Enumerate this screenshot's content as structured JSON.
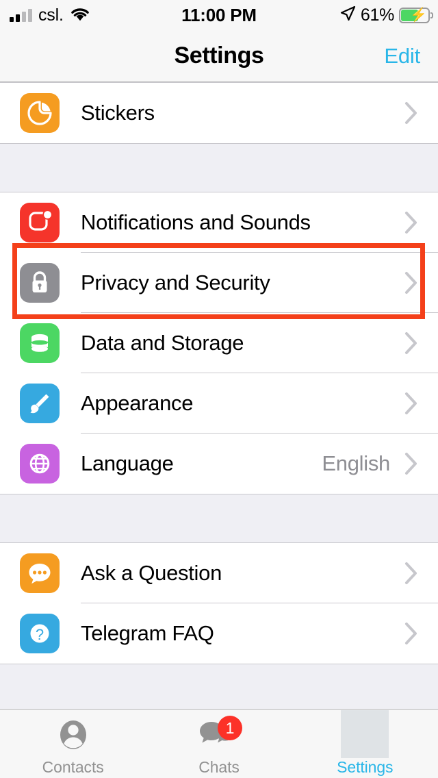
{
  "status_bar": {
    "carrier": "csl.",
    "signal_icon": "cellular-bars-icon",
    "wifi_icon": "wifi-icon",
    "time": "11:00 PM",
    "location_icon": "location-arrow-icon",
    "battery_percent": "61%",
    "battery_icon": "battery-charging-icon",
    "battery_level": 61
  },
  "nav": {
    "title": "Settings",
    "edit_label": "Edit"
  },
  "sections": [
    {
      "rows": [
        {
          "label": "Stickers",
          "value": "",
          "icon": "sticker-icon",
          "icon_color": "#f59c21",
          "chevron": true
        }
      ]
    },
    {
      "rows": [
        {
          "label": "Notifications and Sounds",
          "value": "",
          "icon": "notifications-icon",
          "icon_color": "#f5342b",
          "chevron": true
        },
        {
          "label": "Privacy and Security",
          "value": "",
          "icon": "lock-icon",
          "icon_color": "#8e8e93",
          "chevron": true
        },
        {
          "label": "Data and Storage",
          "value": "",
          "icon": "database-icon",
          "icon_color": "#4cd763",
          "chevron": true
        },
        {
          "label": "Appearance",
          "value": "",
          "icon": "paintbrush-icon",
          "icon_color": "#36a9e0",
          "chevron": true
        },
        {
          "label": "Language",
          "value": "English",
          "icon": "globe-icon",
          "icon_color": "#c863e0",
          "chevron": true
        }
      ]
    },
    {
      "rows": [
        {
          "label": "Ask a Question",
          "value": "",
          "icon": "chat-bubble-dots-icon",
          "icon_color": "#f59c21",
          "chevron": true
        },
        {
          "label": "Telegram FAQ",
          "value": "",
          "icon": "question-mark-icon",
          "icon_color": "#36a9e0",
          "chevron": true
        }
      ]
    }
  ],
  "highlight": {
    "target": "Privacy and Security",
    "color": "#f4401a"
  },
  "tabbar": {
    "tabs": [
      {
        "label": "Contacts",
        "icon": "person-icon",
        "active": false,
        "badge": ""
      },
      {
        "label": "Chats",
        "icon": "chats-bubbles-icon",
        "active": false,
        "badge": "1"
      },
      {
        "label": "Settings",
        "icon": "gear-icon",
        "active": true,
        "badge": ""
      }
    ]
  }
}
